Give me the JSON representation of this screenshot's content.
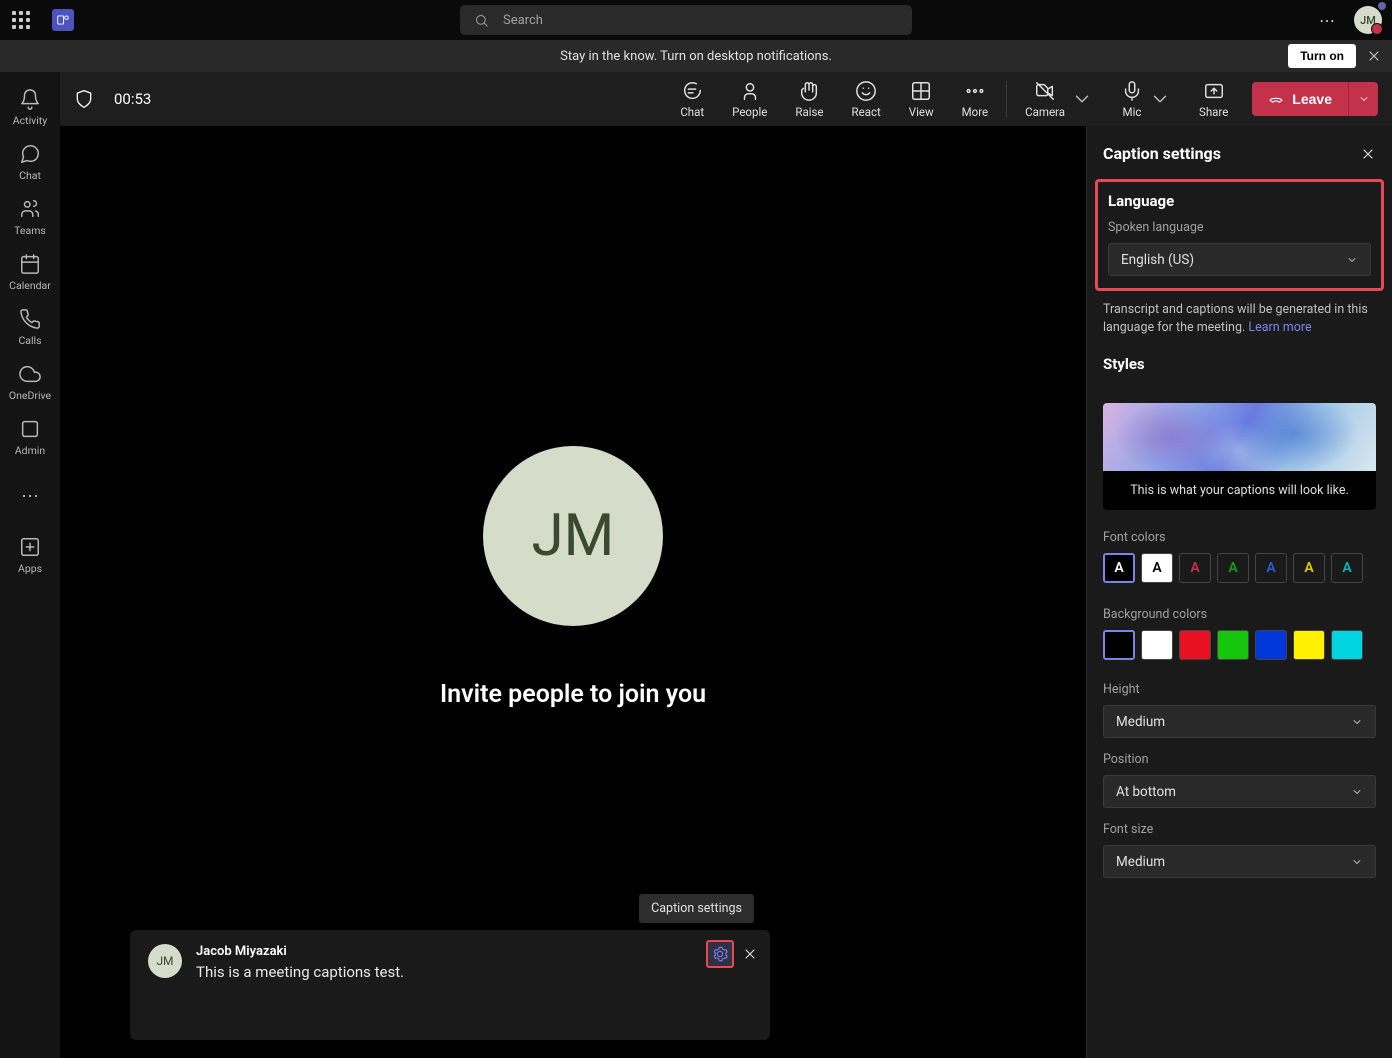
{
  "topbar": {
    "search_placeholder": "Search",
    "avatar_initials": "JM"
  },
  "notification": {
    "text": "Stay in the know. Turn on desktop notifications.",
    "turn_on_label": "Turn on"
  },
  "leftrail": {
    "items": [
      {
        "label": "Activity"
      },
      {
        "label": "Chat"
      },
      {
        "label": "Teams"
      },
      {
        "label": "Calendar"
      },
      {
        "label": "Calls"
      },
      {
        "label": "OneDrive"
      },
      {
        "label": "Admin"
      }
    ],
    "apps_label": "Apps"
  },
  "meetbar": {
    "timer": "00:53",
    "tools": {
      "chat": "Chat",
      "people": "People",
      "raise": "Raise",
      "react": "React",
      "view": "View",
      "more": "More",
      "camera": "Camera",
      "mic": "Mic",
      "share": "Share"
    },
    "leave_label": "Leave"
  },
  "stage": {
    "avatar_initials": "JM",
    "invite_text": "Invite people to join you"
  },
  "caption_bar": {
    "avatar_initials": "JM",
    "name": "Jacob Miyazaki",
    "text": "This is a meeting captions test.",
    "tooltip": "Caption settings"
  },
  "rpanel": {
    "title": "Caption settings",
    "language": {
      "section": "Language",
      "label": "Spoken language",
      "value": "English (US)"
    },
    "help_text": "Transcript and captions will be generated in this language for the meeting.  ",
    "learn_more": "Learn more",
    "styles": {
      "section": "Styles",
      "preview_text": "This is what your captions will look like.",
      "font_colors_label": "Font colors",
      "font_colors": [
        {
          "bg": "#000",
          "fg": "#fff",
          "sel": true
        },
        {
          "bg": "#fff",
          "fg": "#000"
        },
        {
          "bg": "transparent",
          "fg": "#c4314b"
        },
        {
          "bg": "transparent",
          "fg": "#13a10e"
        },
        {
          "bg": "transparent",
          "fg": "#2b5cd6"
        },
        {
          "bg": "transparent",
          "fg": "#dad000"
        },
        {
          "bg": "transparent",
          "fg": "#00b7c3"
        }
      ],
      "bg_colors_label": "Background colors",
      "bg_colors": [
        {
          "bg": "#000",
          "sel": true
        },
        {
          "bg": "#fff"
        },
        {
          "bg": "#e81123"
        },
        {
          "bg": "#16c60c"
        },
        {
          "bg": "#0037da"
        },
        {
          "bg": "#fff100"
        },
        {
          "bg": "#00d4e0"
        }
      ],
      "height_label": "Height",
      "height_value": "Medium",
      "position_label": "Position",
      "position_value": "At bottom",
      "fontsize_label": "Font size",
      "fontsize_value": "Medium"
    }
  }
}
